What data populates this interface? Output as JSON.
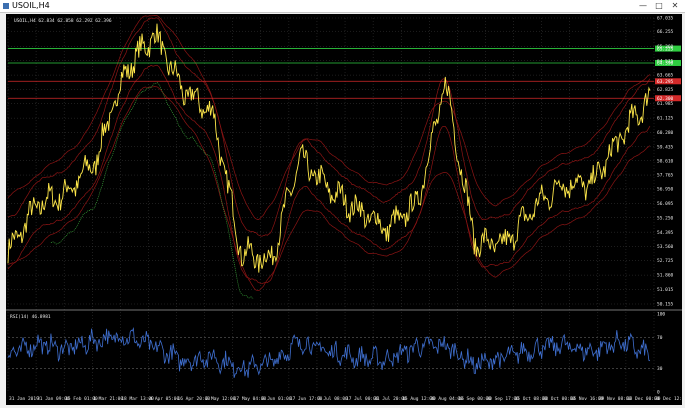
{
  "window": {
    "title": "USOIL,H4",
    "min_glyph": "—",
    "max_glyph": "□",
    "close_glyph": "✕"
  },
  "chart": {
    "info_line": "USOIL,H4 62.834 62.858 62.292 62.396",
    "price_axis": [
      "67.035",
      "66.255",
      "65.360",
      "64.515",
      "63.665",
      "62.825",
      "61.985",
      "61.125",
      "60.280",
      "59.435",
      "58.610",
      "57.765",
      "56.950",
      "56.095",
      "55.250",
      "54.395",
      "53.560",
      "52.725",
      "51.860",
      "51.015",
      "50.155"
    ],
    "price_range": [
      50.155,
      67.035
    ],
    "h_levels": [
      {
        "price": 65.23,
        "label": "65.225",
        "color": "#2ecc40"
      },
      {
        "price": 64.38,
        "label": "64.390",
        "color": "#2ecc40"
      },
      {
        "price": 63.3,
        "label": "63.295",
        "color": "#d42a2a"
      },
      {
        "price": 62.3,
        "label": "62.300",
        "color": "#d42a2a"
      }
    ],
    "time_axis": [
      "31 Jan 2019",
      "31 Jan 09:00",
      "15 Feb 01:00",
      "1 Mar 21:00",
      "18 Mar 13:00",
      "4 Apr 05:00",
      "16 Apr 20:00",
      "2 May 12:00",
      "17 May 04:00",
      "3 Jun 01:00",
      "17 Jun 17:00",
      "2 Jul 08:00",
      "17 Jul 00:00",
      "31 Jul 20:00",
      "15 Aug 12:00",
      "30 Aug 04:00",
      "16 Sep 00:00",
      "30 Sep 17:00",
      "15 Oct 08:00",
      "30 Oct 00:00",
      "15 Nov 16:00",
      "29 Nov 08:00",
      "13 Dec 00:00",
      "30 Dec 12:00"
    ],
    "rsi_label": "RSI(14) 46.8981",
    "rsi_axis": [
      "100",
      "70",
      "30",
      "0"
    ],
    "colors": {
      "background": "#000000",
      "grid": "#4a4a4a",
      "price_line": "#ffe84a",
      "envelope": "#8b1414",
      "green_band": "#3aa83a",
      "rsi_line": "#3f6fd0"
    }
  },
  "chart_data": {
    "type": "line",
    "title": "USOIL,H4",
    "series": [
      {
        "name": "USOIL,H4",
        "x": [
          "31 Jan 2019",
          "15 Feb",
          "1 Mar",
          "18 Mar",
          "4 Apr",
          "16 Apr",
          "2 May",
          "17 May",
          "3 Jun",
          "17 Jun",
          "2 Jul",
          "17 Jul",
          "31 Jul",
          "15 Aug",
          "30 Aug",
          "16 Sep",
          "30 Sep",
          "15 Oct",
          "30 Oct",
          "15 Nov",
          "29 Nov",
          "13 Dec",
          "30 Dec"
        ],
        "values": [
          53.2,
          56.0,
          56.7,
          58.6,
          63.8,
          66.1,
          62.7,
          61.5,
          53.2,
          52.7,
          58.7,
          56.9,
          55.7,
          54.6,
          56.0,
          63.2,
          53.8,
          53.6,
          55.8,
          57.3,
          57.2,
          60.0,
          62.4
        ]
      },
      {
        "name": "RSI(14)",
        "values": [
          48,
          62,
          55,
          66,
          72,
          58,
          40,
          45,
          30,
          38,
          64,
          52,
          44,
          42,
          58,
          60,
          35,
          44,
          55,
          60,
          52,
          65,
          47
        ]
      }
    ],
    "ylim": [
      50.155,
      67.035
    ],
    "rsi_ylim": [
      0,
      100
    ]
  }
}
